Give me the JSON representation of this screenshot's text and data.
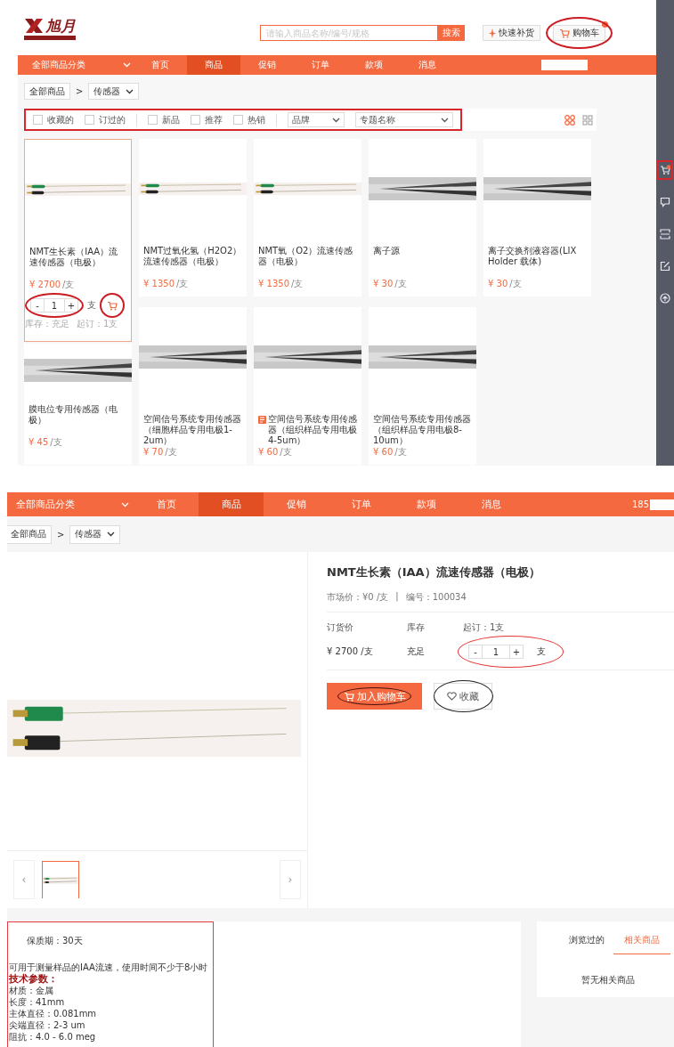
{
  "store": {
    "logo": {
      "text": "旭月"
    },
    "search": {
      "placeholder": "请输入商品名称/编号/规格"
    },
    "search_button": "搜索",
    "quick_button": "快速补货",
    "cart_button": "购物车",
    "nav": {
      "category": "全部商品分类",
      "items": [
        {
          "label": "首页",
          "selected": false
        },
        {
          "label": "商品",
          "selected": true
        },
        {
          "label": "促销",
          "selected": false
        },
        {
          "label": "订单",
          "selected": false
        },
        {
          "label": "款项",
          "selected": false
        },
        {
          "label": "消息",
          "selected": false
        }
      ]
    },
    "breadcrumb": {
      "root": "全部商品",
      "separator": ">",
      "current": "传感器"
    },
    "filters": [
      {
        "label": "收藏的",
        "checked": false
      },
      {
        "label": "订过的",
        "checked": false
      },
      {
        "label": "新品",
        "checked": false
      },
      {
        "label": "推荐",
        "checked": false
      },
      {
        "label": "热销",
        "checked": false
      }
    ],
    "dropdowns": [
      "品牌",
      "专题名称"
    ],
    "view_modes": [
      {
        "kind": "grid",
        "selected": true
      },
      {
        "kind": "list",
        "selected": false
      }
    ],
    "products": [
      {
        "name": "NMT生长素（IAA）流速传感器（电极）",
        "price": "¥ 2700",
        "unit": "/支",
        "hovered": true,
        "quantity": {
          "minus": "-",
          "value": "1",
          "plus": "+"
        },
        "qty_unit": "支",
        "stock": "库存：充足",
        "min_order": "起订：1支",
        "tagged": false
      },
      {
        "name": "NMT过氧化氢（H2O2）流速传感器（电极）",
        "price": "¥ 1350",
        "unit": "/支",
        "hovered": false,
        "tagged": false
      },
      {
        "name": "NMT氧（O2）流速传感器（电极）",
        "price": "¥ 1350",
        "unit": "/支",
        "hovered": false,
        "tagged": false
      },
      {
        "name": "离子源",
        "price": "¥ 30",
        "unit": "/支",
        "hovered": false,
        "tagged": false
      },
      {
        "name": "离子交换剂液容器(LIX Holder 载体)",
        "price": "¥ 30",
        "unit": "/支",
        "hovered": false,
        "tagged": false
      },
      {
        "name": "膜电位专用传感器（电极）",
        "price": "¥ 45",
        "unit": "/支",
        "hovered": false,
        "tagged": false
      },
      {
        "name": "空间信号系统专用传感器（细胞样品专用电极1-2um）",
        "price": "¥ 70",
        "unit": "/支",
        "hovered": false,
        "tagged": false
      },
      {
        "name": "空间信号系统专用传感器（组织样品专用电极4-5um）",
        "price": "¥ 60",
        "unit": "/支",
        "hovered": false,
        "tagged": true
      },
      {
        "name": "空间信号系统专用传感器（组织样品专用电极8-10um）",
        "price": "¥ 60",
        "unit": "/支",
        "hovered": false,
        "tagged": false
      }
    ],
    "sidebar": [
      {
        "kind": "cart",
        "selected": true
      },
      {
        "kind": "chat",
        "selected": false
      },
      {
        "kind": "scan",
        "selected": false
      },
      {
        "kind": "edit",
        "selected": false
      },
      {
        "kind": "top",
        "selected": false
      }
    ]
  },
  "detail": {
    "nav": {
      "category": "全部商品分类",
      "items": [
        {
          "label": "首页",
          "selected": false
        },
        {
          "label": "商品",
          "selected": true
        },
        {
          "label": "促销",
          "selected": false
        },
        {
          "label": "订单",
          "selected": false
        },
        {
          "label": "款项",
          "selected": false
        },
        {
          "label": "消息",
          "selected": false
        }
      ]
    },
    "user": "185",
    "breadcrumb": {
      "root": "全部商品",
      "separator": ">",
      "current": "传感器"
    },
    "title": "NMT生长素（IAA）流速传感器（电极）",
    "market_price": "市场价：¥0 /支",
    "separator": "|",
    "code": "编号：100034",
    "price_label": "订货价",
    "stock_label": "库存",
    "min_order": "起订：1支",
    "prev": "‹",
    "next": "›",
    "price": "¥ 2700 /支",
    "stock": "充足",
    "quantity": {
      "minus": "-",
      "value": "1",
      "plus": "+"
    },
    "unit": "支",
    "add_to_cart": "加入购物车",
    "favorite": "收藏",
    "description": {
      "shelf_life": "保质期：30天",
      "summary": "可用于测量样品的IAA流速，使用时间不少于8小时",
      "specs_title": "技术参数：",
      "specs": [
        "材质：金属",
        "长度：41mm",
        "主体直径：0.081mm",
        "尖端直径：2-3 um",
        "阻抗：4.0 - 6.0 meg"
      ]
    },
    "side_tabs": [
      {
        "label": "浏览过的",
        "selected": false
      },
      {
        "label": "相关商品",
        "selected": true
      }
    ],
    "side_empty": "暂无相关商品"
  }
}
